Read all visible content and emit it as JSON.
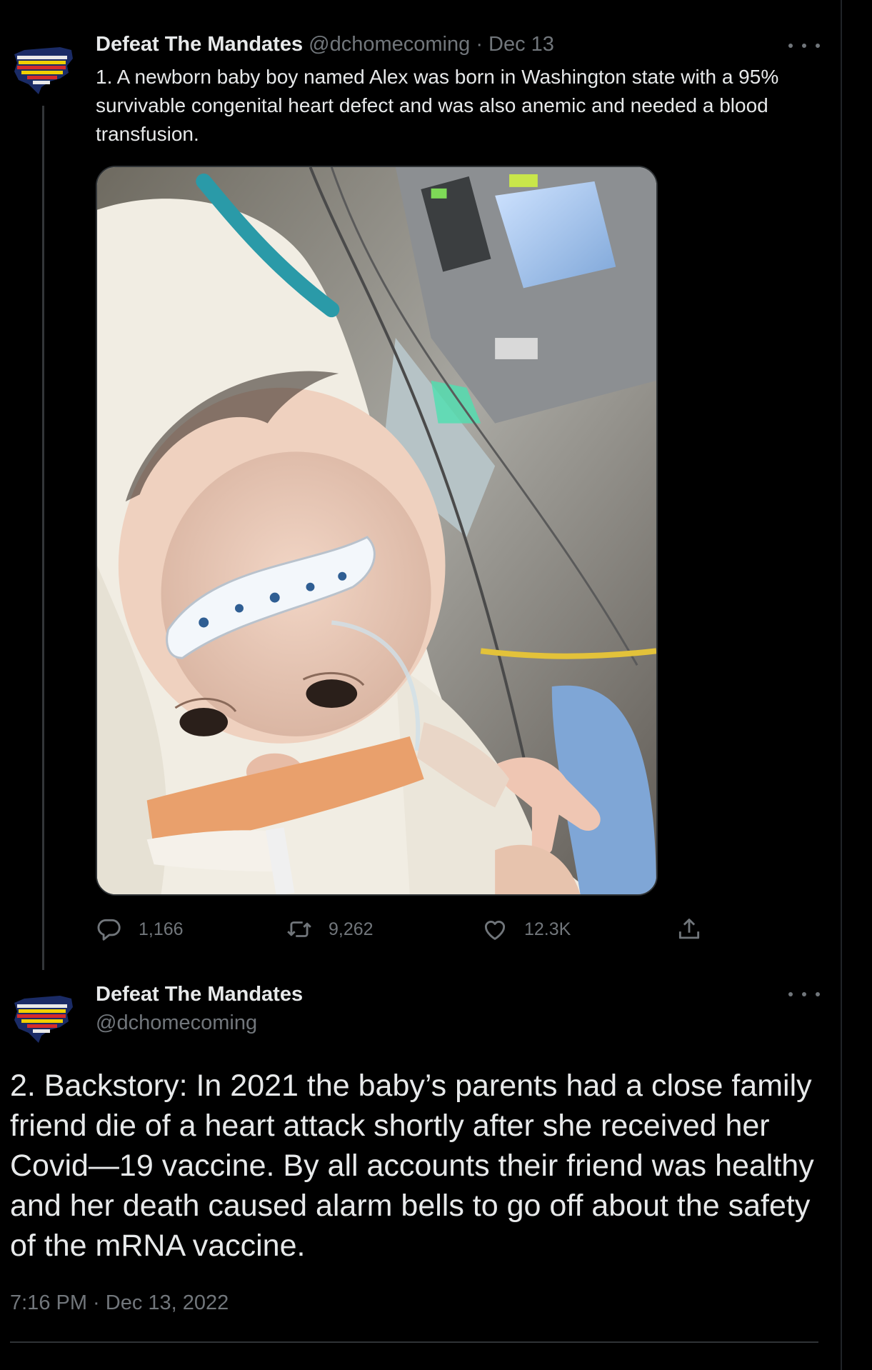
{
  "tweet1": {
    "display_name": "Defeat The Mandates",
    "handle": "@dchomecoming",
    "separator": "·",
    "date": "Dec 13",
    "text": "1. A newborn baby boy named Alex was born in Washington state with a 95% survivable congenital heart defect and was also anemic and needed a blood transfusion.",
    "media_alt": "photo of newborn baby in hospital with medical tubes",
    "actions": {
      "reply_count": "1,166",
      "retweet_count": "9,262",
      "like_count": "12.3K"
    },
    "icons": {
      "reply": "reply-icon",
      "retweet": "retweet-icon",
      "like": "heart-icon",
      "share": "share-icon",
      "more": "more-icon"
    }
  },
  "tweet2": {
    "display_name": "Defeat The Mandates",
    "handle": "@dchomecoming",
    "text": "2. Backstory: In 2021 the baby’s parents had a close family friend die of a heart attack shortly after she received her Covid—19 vaccine. By all accounts their friend was healthy and her death caused alarm bells to go off about the safety of the mRNA vaccine.",
    "timestamp": "7:16 PM · Dec 13, 2022"
  },
  "colors": {
    "background": "#000000",
    "text_primary": "#e7e9ea",
    "text_muted": "#71767b",
    "divider": "#2f3336"
  }
}
